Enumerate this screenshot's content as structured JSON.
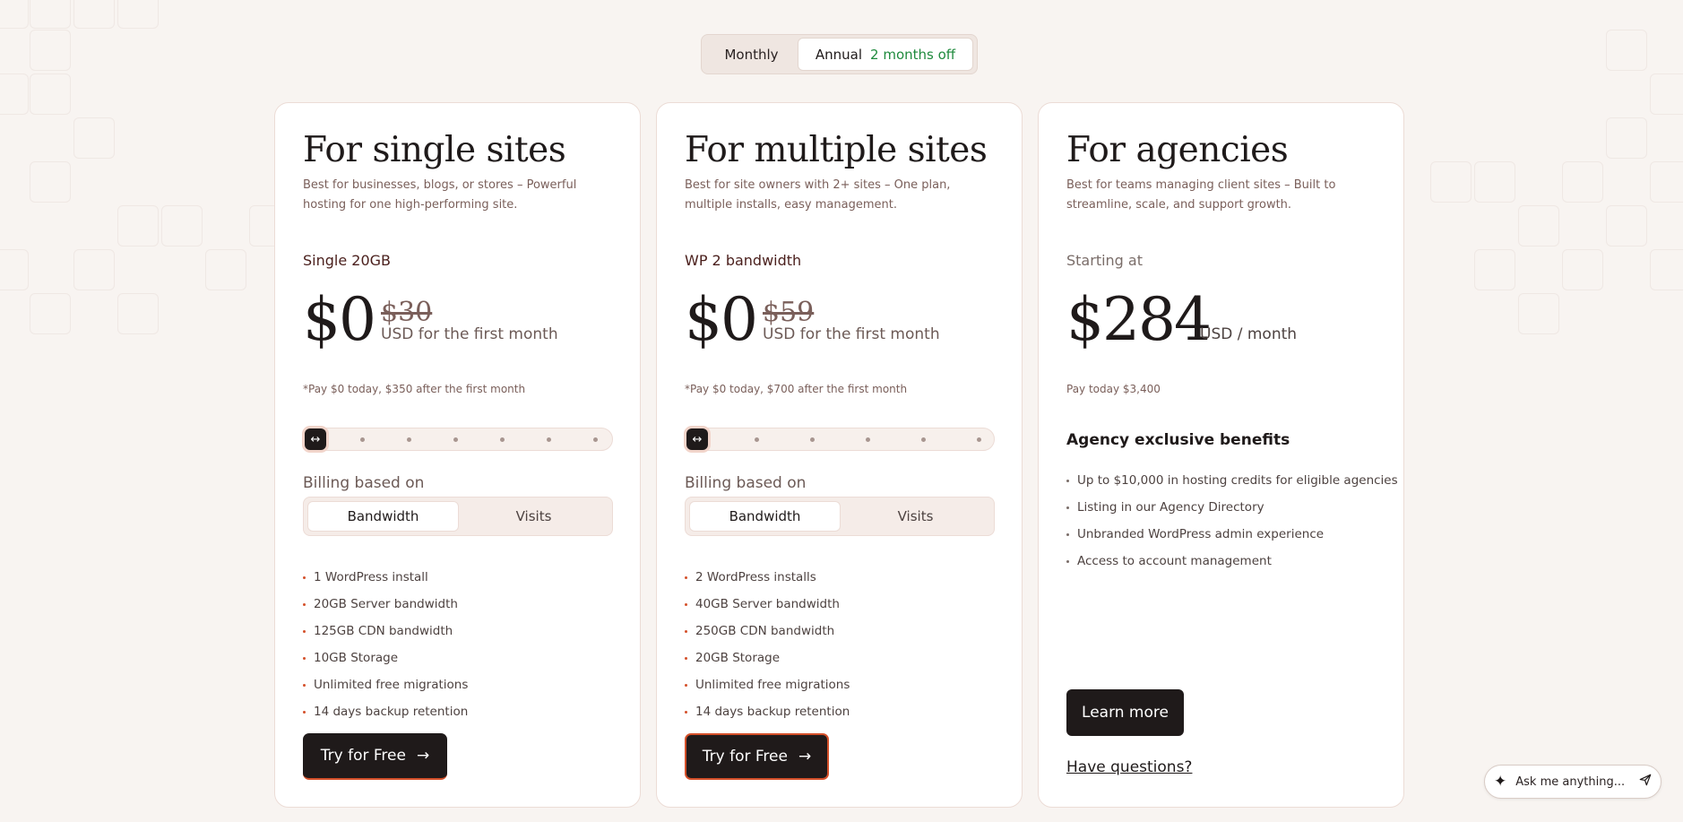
{
  "toggle": {
    "monthly": "Monthly",
    "annual": "Annual",
    "badge": "2 months off"
  },
  "cards": [
    {
      "title": "For single sites",
      "desc": "Best for businesses, blogs, or stores – Powerful hosting for one high-performing site.",
      "plan": "Single 20GB",
      "price": "$0",
      "old_price": "$30",
      "unit": "USD for the first month",
      "note": "*Pay $0 today, $350 after the first month",
      "slider_position": 0,
      "billing_label": "Billing based on",
      "seg": [
        "Bandwidth",
        "Visits"
      ],
      "features": [
        "1 WordPress install",
        "20GB Server bandwidth",
        "125GB CDN bandwidth",
        "10GB Storage",
        "Unlimited free migrations",
        "14 days backup retention"
      ],
      "cta": "Try for Free",
      "cta_icon": "→"
    },
    {
      "title": "For multiple sites",
      "desc": "Best for site owners with 2+ sites – One plan, multiple installs, easy management.",
      "plan": "WP 2 bandwidth",
      "price": "$0",
      "old_price": "$59",
      "unit": "USD for the first month",
      "note": "*Pay $0 today, $700 after the first month",
      "slider_position": 0,
      "billing_label": "Billing based on",
      "seg": [
        "Bandwidth",
        "Visits"
      ],
      "features": [
        "2 WordPress installs",
        "40GB Server bandwidth",
        "250GB CDN bandwidth",
        "20GB Storage",
        "Unlimited free migrations",
        "14 days backup retention"
      ],
      "cta": "Try for Free",
      "cta_icon": "→"
    },
    {
      "title": "For agencies",
      "desc": "Best for teams managing client sites – Built to streamline, scale, and support growth.",
      "starting": "Starting at",
      "price": "$284",
      "unit": "USD / month",
      "note": "Pay today $3,400",
      "benefits_title": "Agency exclusive benefits",
      "features": [
        "Up to $10,000 in hosting credits for eligible agencies",
        "Listing in our Agency Directory",
        "Unbranded WordPress admin experience",
        "Access to account management"
      ],
      "cta": "Learn more",
      "questions": "Have questions?"
    }
  ],
  "ask": {
    "placeholder": "Ask me anything..."
  },
  "colors": {
    "accent": "#d4502a",
    "dark": "#1f1a1a",
    "badge": "#1f8a3d",
    "background": "#f8f4f1"
  },
  "icons": {
    "slider_handle": "arrows-horizontal-icon",
    "cta": "arrow-right-icon",
    "ask": "sparkle-icon",
    "send": "send-icon"
  }
}
